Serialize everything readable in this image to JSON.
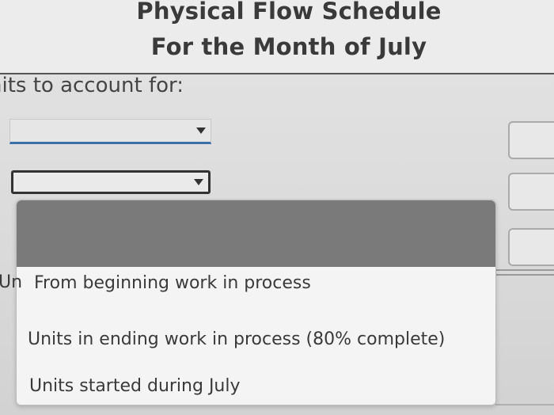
{
  "header": {
    "title": "Physical Flow Schedule",
    "subtitle": "For the Month of July"
  },
  "section": {
    "label": "nits to account for:"
  },
  "dropdown": {
    "clipped_prefix": "Un",
    "options": [
      "From beginning work in process",
      "Units in ending work in process (80% complete)",
      "Units started during July"
    ]
  },
  "colors": {
    "focus_underline": "#3b6fa8",
    "dropdown_header": "#7a7a7a"
  }
}
